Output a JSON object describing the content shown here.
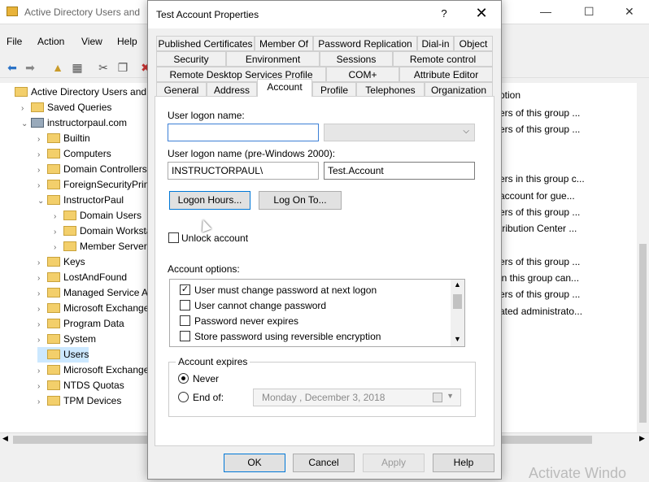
{
  "bg_window": {
    "title": "Active Directory Users and",
    "menu": [
      "File",
      "Action",
      "View",
      "Help"
    ],
    "tree": [
      {
        "label": "Active Directory Users and C",
        "depth": 0,
        "chev": "",
        "icon": "folder"
      },
      {
        "label": "Saved Queries",
        "depth": 1,
        "chev": "›",
        "icon": "folder"
      },
      {
        "label": "instructorpaul.com",
        "depth": 1,
        "chev": "⌄",
        "icon": "domain"
      },
      {
        "label": "Builtin",
        "depth": 2,
        "chev": "›",
        "icon": "folder"
      },
      {
        "label": "Computers",
        "depth": 2,
        "chev": "›",
        "icon": "folder"
      },
      {
        "label": "Domain Controllers",
        "depth": 2,
        "chev": "›",
        "icon": "folder"
      },
      {
        "label": "ForeignSecurityPrinc",
        "depth": 2,
        "chev": "›",
        "icon": "folder"
      },
      {
        "label": "InstructorPaul",
        "depth": 2,
        "chev": "⌄",
        "icon": "folder"
      },
      {
        "label": "Domain Users",
        "depth": 3,
        "chev": "›",
        "icon": "folder"
      },
      {
        "label": "Domain Workstat",
        "depth": 3,
        "chev": "›",
        "icon": "folder"
      },
      {
        "label": "Member Servers",
        "depth": 3,
        "chev": "›",
        "icon": "folder"
      },
      {
        "label": "Keys",
        "depth": 2,
        "chev": "›",
        "icon": "folder"
      },
      {
        "label": "LostAndFound",
        "depth": 2,
        "chev": "›",
        "icon": "folder"
      },
      {
        "label": "Managed Service Ac",
        "depth": 2,
        "chev": "›",
        "icon": "folder"
      },
      {
        "label": "Microsoft Exchange",
        "depth": 2,
        "chev": "›",
        "icon": "folder"
      },
      {
        "label": "Program Data",
        "depth": 2,
        "chev": "›",
        "icon": "folder"
      },
      {
        "label": "System",
        "depth": 2,
        "chev": "›",
        "icon": "folder"
      },
      {
        "label": "Users",
        "depth": 2,
        "chev": "",
        "icon": "folder"
      },
      {
        "label": "Microsoft Exchange",
        "depth": 2,
        "chev": "›",
        "icon": "folder"
      },
      {
        "label": "NTDS Quotas",
        "depth": 2,
        "chev": "›",
        "icon": "folder"
      },
      {
        "label": "TPM Devices",
        "depth": 2,
        "chev": "›",
        "icon": "folder"
      }
    ],
    "right_header": "ption",
    "right_desc": [
      "ers of this group ...",
      "ers of this group ...",
      "",
      "",
      "ers in this group c...",
      " account for gue...",
      "ers of this group ...",
      "tribution Center ...",
      "",
      "ers of this group ...",
      " in this group can...",
      "ers of this group ...",
      "ated administrato..."
    ],
    "watermark": "Activate Windo"
  },
  "dialog": {
    "title": "Test Account Properties",
    "help": "?",
    "close": "✕",
    "tabs_row1": [
      "Published Certificates",
      "Member Of",
      "Password Replication",
      "Dial-in",
      "Object"
    ],
    "tabs_row2": [
      "Security",
      "Environment",
      "Sessions",
      "Remote control"
    ],
    "tabs_row3": [
      "Remote Desktop Services Profile",
      "COM+",
      "Attribute Editor"
    ],
    "tabs_row4": [
      "General",
      "Address",
      "Account",
      "Profile",
      "Telephones",
      "Organization"
    ],
    "active_tab": "Account",
    "logon_name_label": "User logon name:",
    "logon_name_value": "",
    "logon_pre2000_label": "User logon name (pre-Windows 2000):",
    "domain_prefix": "INSTRUCTORPAUL\\",
    "sam_account": "Test.Account",
    "logon_hours_btn": "Logon Hours...",
    "logon_to_btn": "Log On To...",
    "unlock_label": "Unlock account",
    "account_options_label": "Account options:",
    "account_options": [
      {
        "label": "User must change password at next logon",
        "checked": true
      },
      {
        "label": "User cannot change password",
        "checked": false
      },
      {
        "label": "Password never expires",
        "checked": false
      },
      {
        "label": "Store password using reversible encryption",
        "checked": false
      }
    ],
    "account_expires_label": "Account expires",
    "never_label": "Never",
    "end_of_label": "End of:",
    "end_of_date": "Monday    ,  December   3, 2018",
    "buttons": {
      "ok": "OK",
      "cancel": "Cancel",
      "apply": "Apply",
      "help": "Help"
    }
  }
}
